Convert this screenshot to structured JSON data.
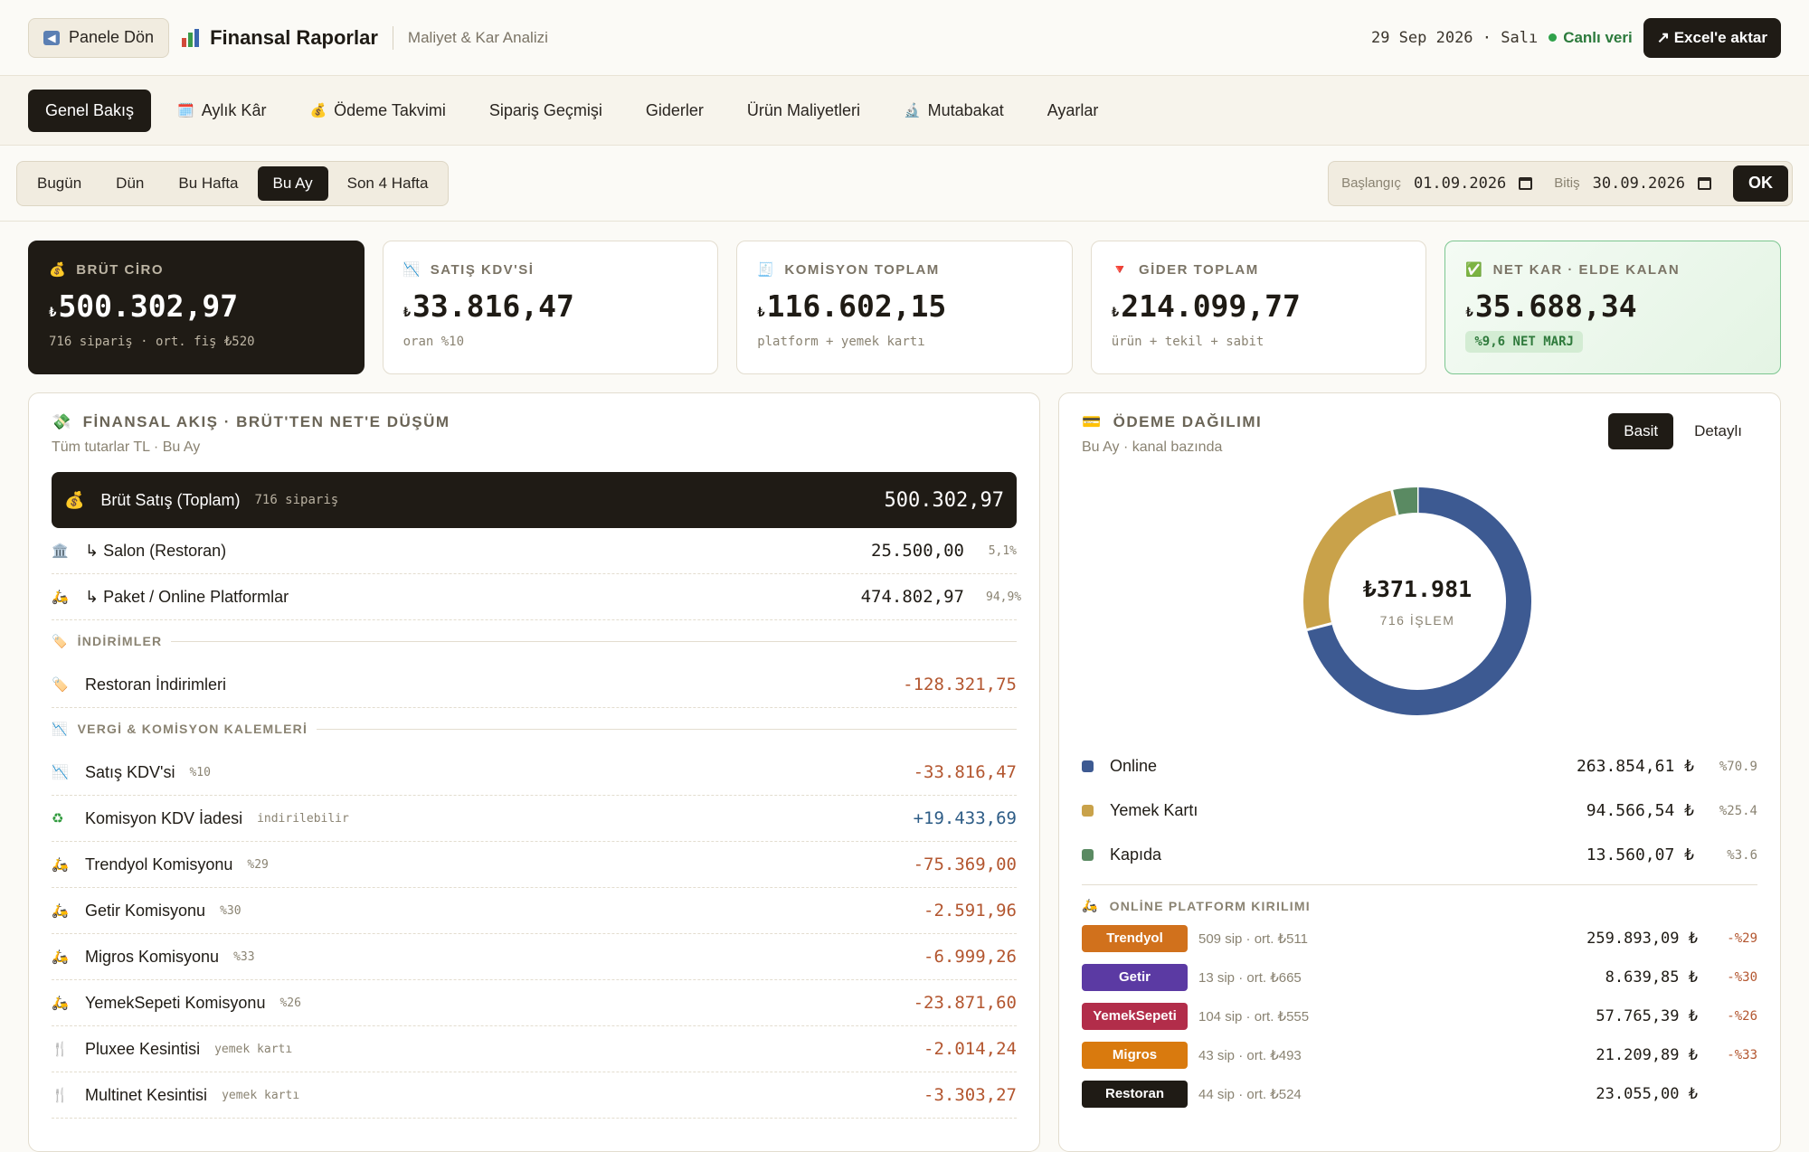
{
  "topbar": {
    "back_label": "Panele Dön",
    "title": "Finansal Raporlar",
    "subtitle": "Maliyet & Kar Analizi",
    "date": "29 Sep 2026 · Salı",
    "live_label": "Canlı veri",
    "export_label": "↗ Excel'e aktar"
  },
  "tabs": [
    {
      "label": "Genel Bakış",
      "icon": ""
    },
    {
      "label": "Aylık Kâr",
      "icon": "calendar-icon"
    },
    {
      "label": "Ödeme Takvimi",
      "icon": "money-bag-icon"
    },
    {
      "label": "Sipariş Geçmişi",
      "icon": ""
    },
    {
      "label": "Giderler",
      "icon": ""
    },
    {
      "label": "Ürün Maliyetleri",
      "icon": ""
    },
    {
      "label": "Mutabakat",
      "icon": "microscope-icon"
    },
    {
      "label": "Ayarlar",
      "icon": ""
    }
  ],
  "range": {
    "options": [
      "Bugün",
      "Dün",
      "Bu Hafta",
      "Bu Ay",
      "Son 4 Hafta"
    ],
    "active": "Bu Ay",
    "start_label": "Başlangıç",
    "start_value": "01.09.2026",
    "end_label": "Bitiş",
    "end_value": "30.09.2026",
    "ok_label": "OK"
  },
  "kpis": [
    {
      "label": "BRÜT CİRO",
      "currency": "₺",
      "value": "500.302,97",
      "sub": "716 sipariş · ort. fiş ₺520"
    },
    {
      "label": "SATIŞ KDV'Sİ",
      "currency": "₺",
      "value": "33.816,47",
      "sub": "oran %10"
    },
    {
      "label": "KOMİSYON TOPLAM",
      "currency": "₺",
      "value": "116.602,15",
      "sub": "platform + yemek kartı"
    },
    {
      "label": "GİDER TOPLAM",
      "currency": "₺",
      "value": "214.099,77",
      "sub": "ürün + tekil + sabit"
    },
    {
      "label": "NET KAR · ELDE KALAN",
      "currency": "₺",
      "value": "35.688,34",
      "sub": "%9,6 NET MARJ"
    }
  ],
  "flow": {
    "title": "FİNANSAL AKIŞ · BRÜT'TEN NET'E DÜŞÜM",
    "subtitle": "Tüm tutarlar TL · Bu Ay",
    "hero": {
      "label": "Brüt Satış (Toplam)",
      "tag": "716 sipariş",
      "amount": "500.302,97"
    },
    "channels": [
      {
        "label": "↳ Salon (Restoran)",
        "amount": "25.500,00",
        "pct": "5,1%"
      },
      {
        "label": "↳ Paket / Online Platformlar",
        "amount": "474.802,97",
        "pct": "94,9%"
      }
    ],
    "discount_section": "İNDİRİMLER",
    "discounts": [
      {
        "label": "Restoran İndirimleri",
        "tag": "",
        "amount": "-128.321,75"
      }
    ],
    "tax_section": "VERGİ & KOMİSYON KALEMLERİ",
    "items": [
      {
        "label": "Satış KDV'si",
        "tag": "%10",
        "amount": "-33.816,47",
        "kind": "neg",
        "icon": "chart-down-icon"
      },
      {
        "label": "Komisyon KDV İadesi",
        "tag": "indirilebilir",
        "amount": "+19.433,69",
        "kind": "pos",
        "icon": "recycle-icon"
      },
      {
        "label": "Trendyol Komisyonu",
        "tag": "%29",
        "amount": "-75.369,00",
        "kind": "neg",
        "icon": "scooter-icon"
      },
      {
        "label": "Getir Komisyonu",
        "tag": "%30",
        "amount": "-2.591,96",
        "kind": "neg",
        "icon": "scooter-icon"
      },
      {
        "label": "Migros Komisyonu",
        "tag": "%33",
        "amount": "-6.999,26",
        "kind": "neg",
        "icon": "scooter-icon"
      },
      {
        "label": "YemekSepeti Komisyonu",
        "tag": "%26",
        "amount": "-23.871,60",
        "kind": "neg",
        "icon": "scooter-icon"
      },
      {
        "label": "Pluxee Kesintisi",
        "tag": "yemek kartı",
        "amount": "-2.014,24",
        "kind": "neg",
        "icon": "fork-knife-icon"
      },
      {
        "label": "Multinet Kesintisi",
        "tag": "yemek kartı",
        "amount": "-3.303,27",
        "kind": "neg",
        "icon": "fork-knife-icon"
      }
    ]
  },
  "payment": {
    "title": "ÖDEME DAĞILIMI",
    "subtitle": "Bu Ay · kanal bazında",
    "toggle": [
      "Basit",
      "Detaylı"
    ],
    "total": "₺371.981",
    "count_label": "716 İŞLEM",
    "colors": {
      "online": "#3d5a92",
      "yemek": "#c9a24a",
      "kapida": "#5a8a62"
    },
    "legend": [
      {
        "name": "Online",
        "value": "263.854,61 ₺",
        "pct": "%70.9",
        "share": 70.9,
        "color": "#3d5a92"
      },
      {
        "name": "Yemek Kartı",
        "value": "94.566,54 ₺",
        "pct": "%25.4",
        "share": 25.4,
        "color": "#c9a24a"
      },
      {
        "name": "Kapıda",
        "value": "13.560,07 ₺",
        "pct": "%3.6",
        "share": 3.6,
        "color": "#5a8a62"
      }
    ],
    "platform_title": "ONLİNE PLATFORM KIRILIMI",
    "platforms": [
      {
        "name": "Trendyol",
        "meta": "509 sip · ort. ₺511",
        "value": "259.893,09 ₺",
        "cut": "-%29",
        "color": "#d1711c"
      },
      {
        "name": "Getir",
        "meta": "13 sip · ort. ₺665",
        "value": "8.639,85 ₺",
        "cut": "-%30",
        "color": "#5b3aa3"
      },
      {
        "name": "YemekSepeti",
        "meta": "104 sip · ort. ₺555",
        "value": "57.765,39 ₺",
        "cut": "-%26",
        "color": "#b22d4a"
      },
      {
        "name": "Migros",
        "meta": "43 sip · ort. ₺493",
        "value": "21.209,89 ₺",
        "cut": "-%33",
        "color": "#d97a0e"
      },
      {
        "name": "Restoran",
        "meta": "44 sip · ort. ₺524",
        "value": "23.055,00 ₺",
        "cut": "",
        "color": "#1f1b15"
      }
    ]
  }
}
